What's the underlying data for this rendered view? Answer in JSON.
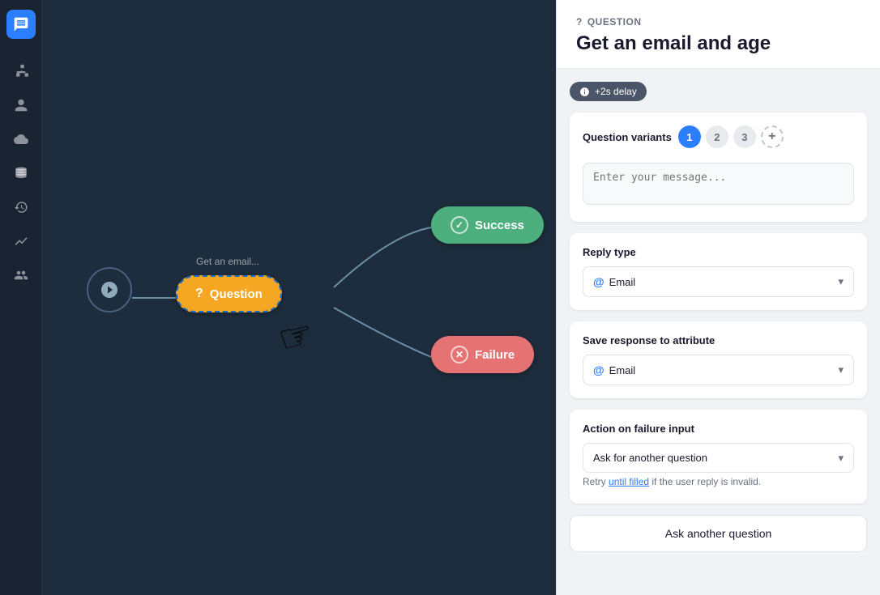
{
  "sidebar": {
    "logo_label": "Chat",
    "icons": [
      {
        "name": "org-chart-icon",
        "symbol": "⊞",
        "label": "Organization"
      },
      {
        "name": "users-icon",
        "symbol": "👤",
        "label": "Users"
      },
      {
        "name": "cloud-icon",
        "symbol": "☁",
        "label": "Cloud"
      },
      {
        "name": "database-icon",
        "symbol": "🗄",
        "label": "Database"
      },
      {
        "name": "clock-icon",
        "symbol": "🕐",
        "label": "History"
      },
      {
        "name": "analytics-icon",
        "symbol": "↗",
        "label": "Analytics"
      },
      {
        "name": "team-icon",
        "symbol": "👥",
        "label": "Team"
      }
    ]
  },
  "canvas": {
    "start_node_label": "Start",
    "question_node_label": "Get an email...",
    "question_node_text": "? Question",
    "success_node_text": "Success",
    "failure_node_text": "Failure"
  },
  "panel": {
    "type_label": "QUESTION",
    "title": "Get an email and age",
    "delay_badge": "+2s delay",
    "question_variants_label": "Question variants",
    "variant_1": "1",
    "variant_2": "2",
    "variant_3": "3",
    "variant_add": "+",
    "message_placeholder": "Enter your message...",
    "reply_type_label": "Reply type",
    "reply_type_value": "Email",
    "reply_type_icon": "@",
    "save_response_label": "Save response to attribute",
    "save_response_value": "Email",
    "save_response_icon": "@",
    "action_failure_label": "Action on failure input",
    "action_failure_value": "Ask for another question",
    "retry_text_before": "Retry",
    "retry_link": "until filled",
    "retry_text_after": "if the user reply is invalid.",
    "ask_another_btn": "Ask another question"
  }
}
